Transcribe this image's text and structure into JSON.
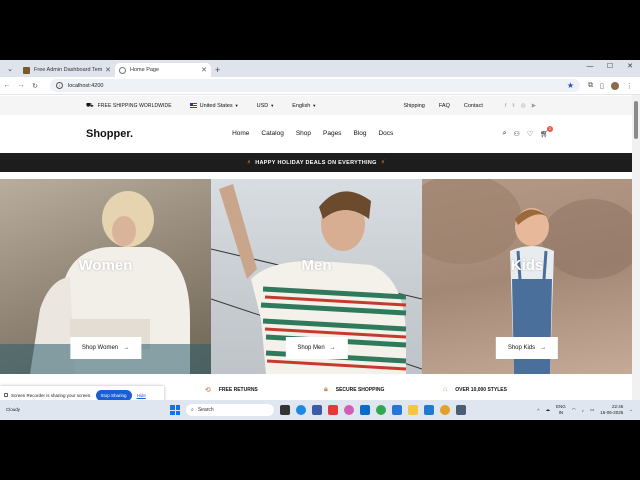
{
  "browser": {
    "tabs": [
      {
        "title": "Free Admin Dashboard Templates",
        "favicon_color": "#7a5a2a",
        "active": false
      },
      {
        "title": "Home Page",
        "favicon_color": "#6b7785",
        "active": true
      }
    ],
    "new_tab_symbol": "+",
    "url": "localhost:4200"
  },
  "topbar": {
    "shipping_notice": "FREE SHIPPING WORLDWIDE",
    "country": "United States",
    "currency": "USD",
    "language": "English",
    "links": [
      "Shipping",
      "FAQ",
      "Contact"
    ],
    "socials": [
      "facebook-icon",
      "twitter-icon",
      "instagram-icon",
      "youtube-icon"
    ]
  },
  "nav": {
    "logo": "Shopper.",
    "menu": [
      "Home",
      "Catalog",
      "Shop",
      "Pages",
      "Blog",
      "Docs"
    ],
    "cart_count": "2"
  },
  "banner": {
    "text": "HAPPY HOLIDAY DEALS ON EVERYTHING",
    "accent": "#f2a33a"
  },
  "hero": {
    "panels": [
      {
        "title": "Women",
        "button": "Shop Women"
      },
      {
        "title": "Men",
        "button": "Shop Men"
      },
      {
        "title": "Kids",
        "button": "Shop Kids"
      }
    ]
  },
  "features": [
    {
      "label": "FREE RETURNS",
      "icon": "refresh-icon"
    },
    {
      "label": "SECURE SHOPPING",
      "icon": "lock-icon"
    },
    {
      "label": "OVER 10,000 STYLES",
      "icon": "tag-icon"
    }
  ],
  "recorder": {
    "message": "Screen Recorder is sharing your screen.",
    "stop_label": "Stop Sharing",
    "hide_label": "Hide"
  },
  "taskbar": {
    "weather": "Cloudy",
    "search_placeholder": "Search",
    "lang_top": "ENG",
    "lang_bottom": "IN",
    "time": "22:46",
    "date": "16-06-2025"
  }
}
